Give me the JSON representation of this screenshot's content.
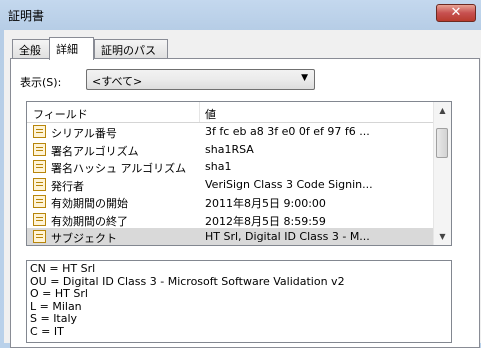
{
  "window": {
    "title": "証明書",
    "close_symbol": "✕"
  },
  "tabs": [
    {
      "label": "全般",
      "active": false
    },
    {
      "label": "詳細",
      "active": true
    },
    {
      "label": "証明のパス",
      "active": false
    }
  ],
  "show": {
    "label": "表示(S):",
    "selected": "<すべて>"
  },
  "list": {
    "columns": [
      "フィールド",
      "値"
    ],
    "rows": [
      {
        "field": "シリアル番号",
        "value": "3f fc eb a8 3f e0 0f ef 97 f6 ..."
      },
      {
        "field": "署名アルゴリズム",
        "value": "sha1RSA"
      },
      {
        "field": "署名ハッシュ アルゴリズム",
        "value": "sha1"
      },
      {
        "field": "発行者",
        "value": "VeriSign Class 3 Code Signin..."
      },
      {
        "field": "有効期間の開始",
        "value": "2011年8月5日 9:00:00"
      },
      {
        "field": "有効期間の終了",
        "value": "2012年8月5日 8:59:59"
      },
      {
        "field": "サブジェクト",
        "value": "HT Srl, Digital ID Class 3 - M..."
      }
    ],
    "selected_index": 6
  },
  "details_lines": [
    "CN = HT Srl",
    "OU = Digital ID Class 3 - Microsoft Software Validation v2",
    "O = HT Srl",
    "L = Milan",
    "S = Italy",
    "C = IT"
  ]
}
